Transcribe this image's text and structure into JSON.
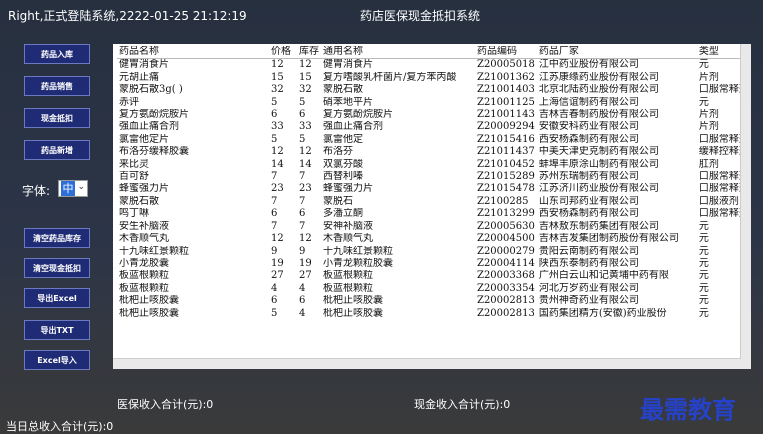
{
  "titlebar": {
    "status": "Right,正式登陆系统,2222-01-25 21:12:19",
    "title": "药店医保现金抵扣系统"
  },
  "sidebar": {
    "buttons": [
      "药品入库",
      "药品销售",
      "现金抵扣",
      "药品新增",
      "清空药品库存",
      "清空现金抵扣",
      "导出Excel",
      "导出TXT",
      "Excel导入"
    ],
    "font_label": "字体:",
    "font_value": "中"
  },
  "table": {
    "columns": [
      "药品名称",
      "价格",
      "库存",
      "通用名称",
      "药品编码",
      "药品厂家",
      "类型"
    ],
    "rows": [
      [
        "健胃消食片",
        "12",
        "12",
        "健胃消食片",
        "Z20005018",
        "江中药业股份有限公司",
        "元"
      ],
      [
        "元胡止痛",
        "15",
        "15",
        "复方嗜酸乳杆菌片/复方苯丙酸",
        "Z21001362",
        "江苏康缘药业股份有限公司",
        "片剂"
      ],
      [
        "蒙脱石散3g(  )",
        "32",
        "32",
        "蒙脱石散",
        "Z21001403",
        "北京北陆药业股份有限公司",
        "口服常释剂"
      ],
      [
        "赤评",
        "5",
        "5",
        "硝苯地平片",
        "Z21001125",
        "上海信谊制药有限公司",
        "元"
      ],
      [
        "复方氨酚烷胺片",
        "6",
        "6",
        "复方氨酚烷胺片",
        "Z21001143",
        "吉林吉春制药股份有限公司",
        "片剂"
      ],
      [
        "强血止痛合剂",
        "33",
        "33",
        "强血止痛合剂",
        "Z20009294",
        "安徽安科药业有限公司",
        "片剂"
      ],
      [
        "氯雷他定片",
        "5",
        "5",
        "氯雷他定",
        "Z21015416",
        "西安杨森制药有限公司",
        "口服常释剂"
      ],
      [
        "布洛芬缓释胶囊",
        "12",
        "12",
        "布洛芬",
        "Z21011437",
        "中美天津史克制药有限公司",
        "缓释控释剂"
      ],
      [
        "来比灵",
        "14",
        "14",
        "双氯芬酸",
        "Z21010452",
        "蚌埠丰原涂山制药有限公司",
        "肛剂"
      ],
      [
        "百可舒",
        "7",
        "7",
        "西替利嗪",
        "Z21015289",
        "苏州东瑞制药有限公司",
        "口服常释剂"
      ],
      [
        "蜂蜜强力片",
        "23",
        "23",
        "蜂蜜强力片",
        "Z21015478",
        "江苏济川药业股份有限公司",
        "口服常释剂"
      ],
      [
        "蒙脱石散",
        "7",
        "7",
        "蒙脱石",
        "Z2100285",
        "山东司邦药业有限公司",
        "口服液剂"
      ],
      [
        "鸣丁啉",
        "6",
        "6",
        "多潘立酮",
        "Z21013299",
        "西安杨森制药有限公司",
        "口服常释剂"
      ],
      [
        "安生补脑液",
        "7",
        "7",
        "安神补脑液",
        "Z20005630",
        "吉林敖东制药集团有限公司",
        "元"
      ],
      [
        "木香顺气丸",
        "12",
        "12",
        "木香顺气丸",
        "Z20004500",
        "吉林吉发集团制药股份有限公司",
        "元"
      ],
      [
        "十九味红景颗粒",
        "9",
        "9",
        "十九味红景颗粒",
        "Z20000279",
        "贵阳云南制药有限公司",
        "元"
      ],
      [
        "小青龙胶囊",
        "19",
        "19",
        "小青龙颗粒胶囊",
        "Z20004114",
        "陕西东泰制药有限公司",
        "元"
      ],
      [
        "板蓝根颗粒",
        "27",
        "27",
        "板蓝根颗粒",
        "Z20003368",
        "广州白云山和记黄埔中药有限",
        "元"
      ],
      [
        "板蓝根颗粒",
        "4",
        "4",
        "板蓝根颗粒",
        "Z20003354",
        "河北万岁药业有限公司",
        "元"
      ],
      [
        "枇杷止咳胶囊",
        "6",
        "6",
        "枇杷止咳胶囊",
        "Z20002813",
        "贵州神奇药业有限公司",
        "元"
      ],
      [
        "枇杷止咳胶囊",
        "5",
        "4",
        "枇杷止咳胶囊",
        "Z20002813",
        "国药集团精方(安徽)药业股份",
        "元"
      ]
    ]
  },
  "summary": {
    "medical_insurance_total": "医保收入合计(元):0",
    "cash_total": "现金收入合计(元):0",
    "day_total": "当日总收入合计(元):0"
  },
  "watermark": "最需教育"
}
